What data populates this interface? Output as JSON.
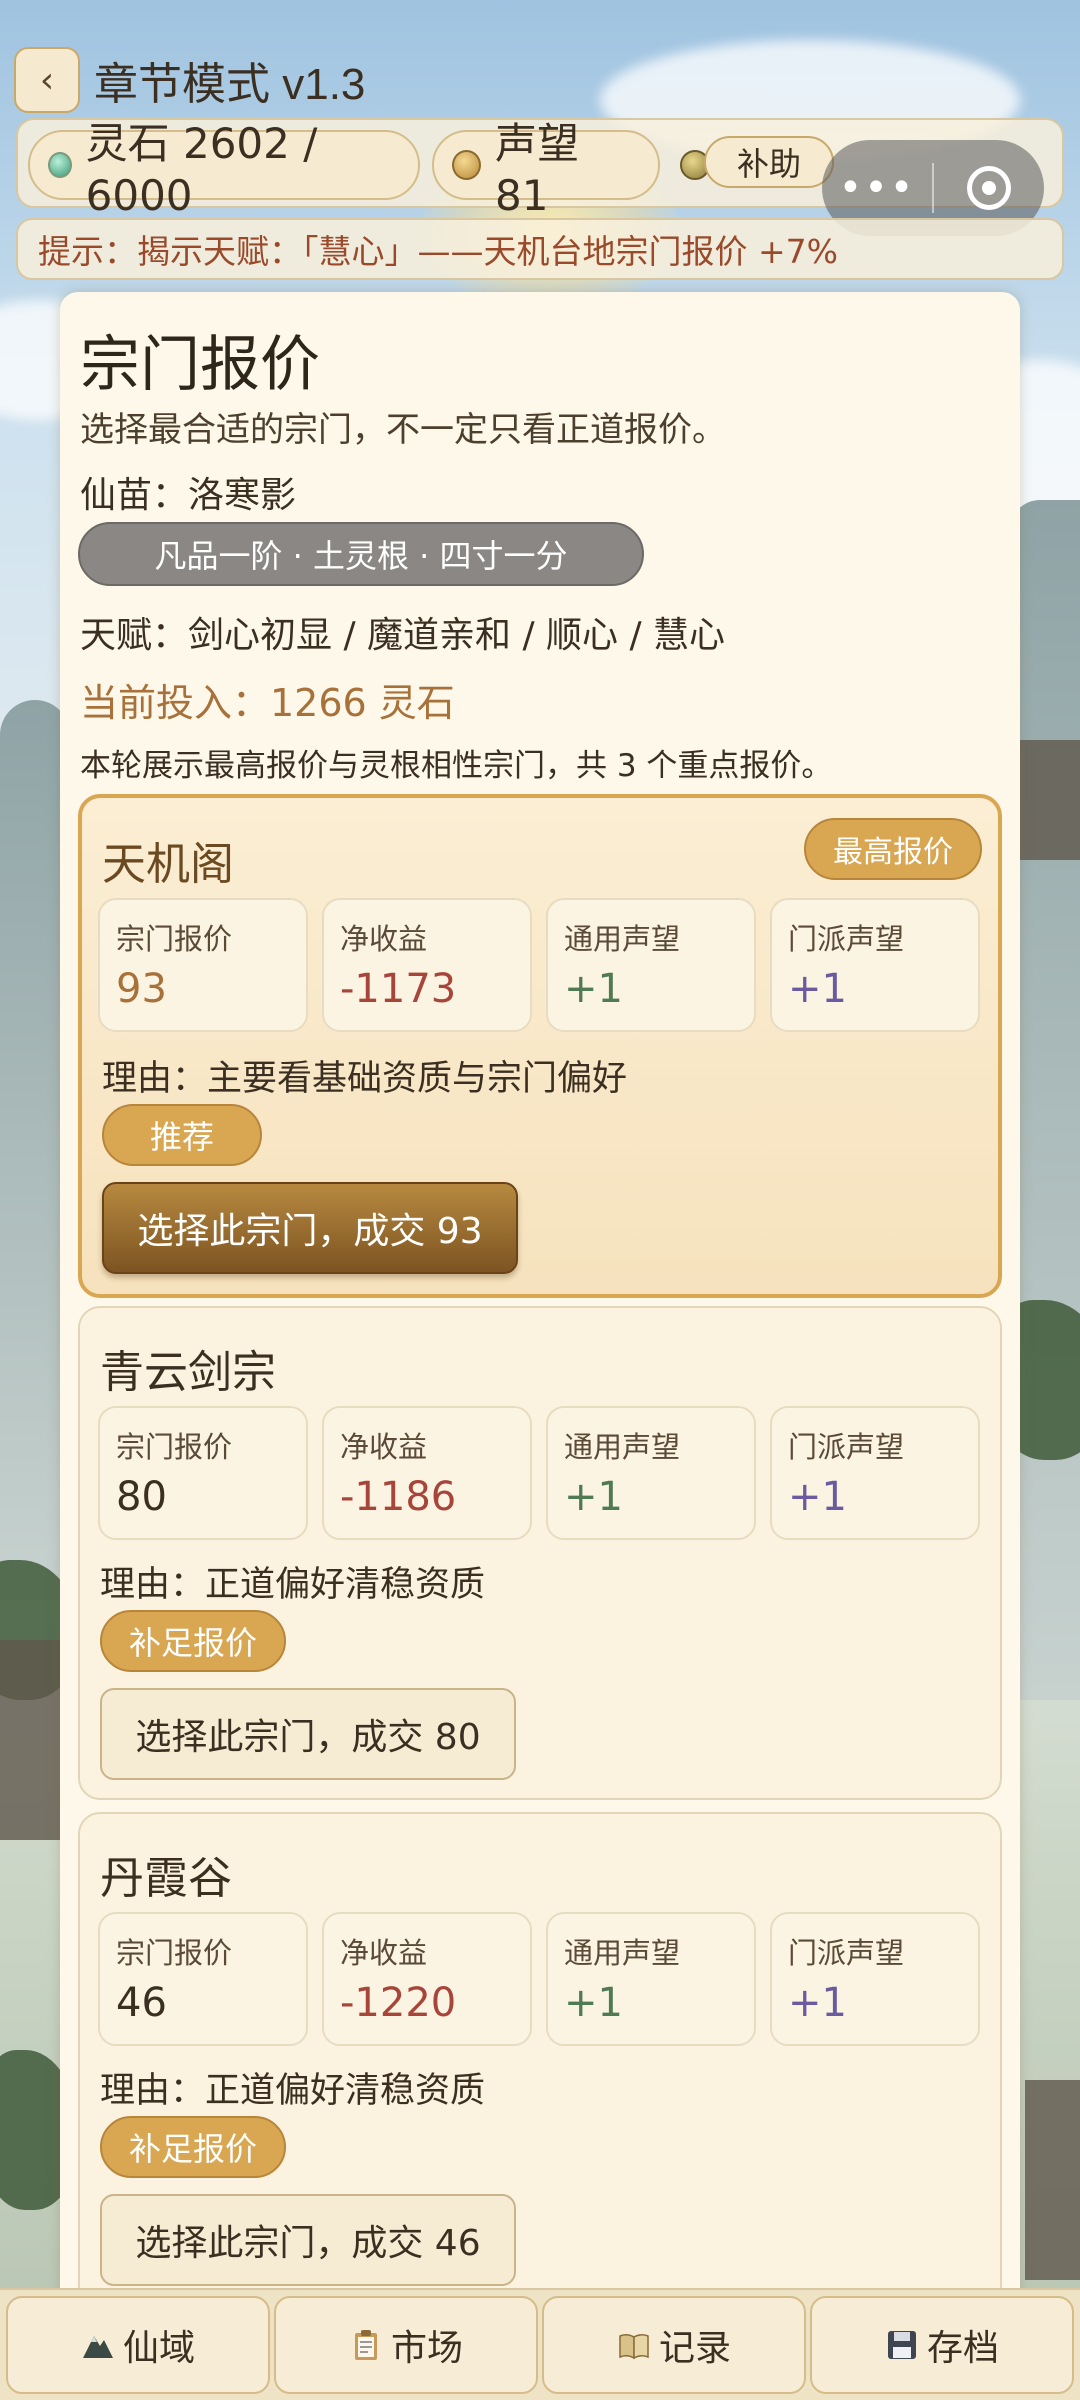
{
  "header": {
    "title": "章节模式 v1.3",
    "back_icon": "‹"
  },
  "resources": {
    "spirit_stone": "灵石 2602 / 6000",
    "reputation": "声望 81",
    "assist_label": "补助"
  },
  "capsule": {
    "more": "•••"
  },
  "hint": "提示：揭示天赋：「慧心」——天机台地宗门报价 +7%",
  "panel": {
    "title": "宗门报价",
    "subtitle": "选择最合适的宗门，不一定只看正道报价。",
    "seedling": "仙苗：洛寒影",
    "grade_tag": "凡品一阶 · 土灵根 · 四寸一分",
    "talents": "天赋：剑心初显 / 魔道亲和 / 顺心 / 慧心",
    "investment": "当前投入：1266 灵石",
    "summary": "本轮展示最高报价与灵根相性宗门，共 3 个重点报价。"
  },
  "stat_labels": {
    "price": "宗门报价",
    "net": "净收益",
    "general_rep": "通用声望",
    "faction_rep": "门派声望"
  },
  "offers": [
    {
      "name": "天机阁",
      "badge": "最高报价",
      "price": "93",
      "net": "-1173",
      "general_rep": "+1",
      "faction_rep": "+1",
      "reason": "理由：主要看基础资质与宗门偏好",
      "tag": "推荐",
      "action": "选择此宗门，成交 93"
    },
    {
      "name": "青云剑宗",
      "price": "80",
      "net": "-1186",
      "general_rep": "+1",
      "faction_rep": "+1",
      "reason": "理由：正道偏好清稳资质",
      "tag": "补足报价",
      "action": "选择此宗门，成交 80"
    },
    {
      "name": "丹霞谷",
      "price": "46",
      "net": "-1220",
      "general_rep": "+1",
      "faction_rep": "+1",
      "reason": "理由：正道偏好清稳资质",
      "tag": "补足报价",
      "action": "选择此宗门，成交 46"
    }
  ],
  "nav": [
    {
      "label": "仙域",
      "icon": "mountain-icon"
    },
    {
      "label": "市场",
      "icon": "clipboard-icon"
    },
    {
      "label": "记录",
      "icon": "book-icon"
    },
    {
      "label": "存档",
      "icon": "floppy-disk-icon"
    }
  ],
  "colors": {
    "accent_gold": "#d9a652",
    "primary_button": "#7d5422",
    "negative": "#a8453a",
    "general_rep": "#4f7a52",
    "faction_rep": "#6a5aa0",
    "hint_text": "#9a4a2a"
  }
}
